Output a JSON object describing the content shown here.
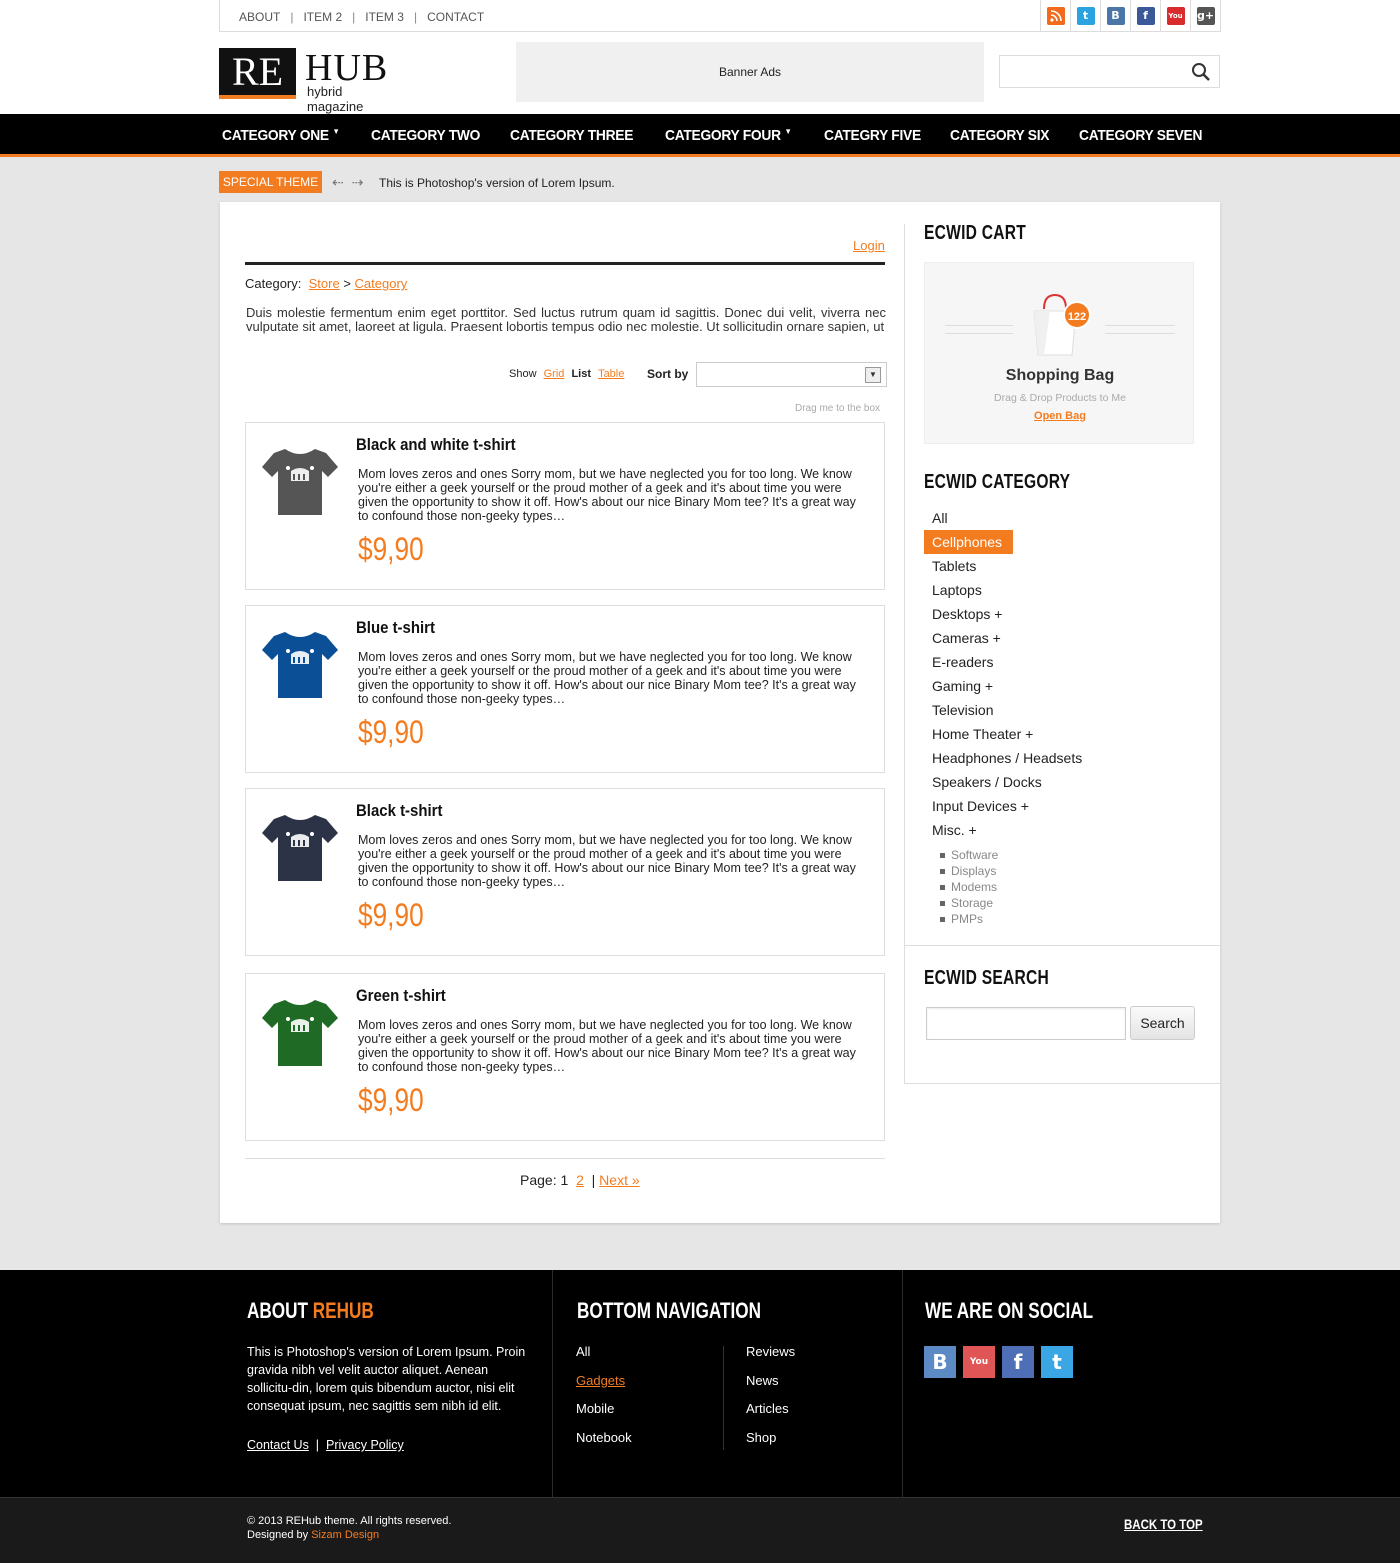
{
  "topnav": {
    "links": [
      "ABOUT",
      "ITEM 2",
      "ITEM 3",
      "CONTACT"
    ],
    "social_icons": [
      "rss-icon",
      "twitter-icon",
      "vk-icon",
      "facebook-icon",
      "youtube-icon",
      "google-plus-icon"
    ]
  },
  "logo": {
    "mark": "RE",
    "name": "HUB",
    "tagline": "hybrid magazine"
  },
  "banner": {
    "text": "Banner Ads"
  },
  "mainnav": {
    "items": [
      "CATEGORY ONE",
      "CATEGORY TWO",
      "CATEGORY THREE",
      "CATEGORY FOUR",
      "CATEGRY FIVE",
      "CATEGORY SIX",
      "CATEGORY SEVEN"
    ]
  },
  "ticker": {
    "badge": "SPECIAL THEME",
    "text": "This is Photoshop's version  of Lorem Ipsum."
  },
  "content": {
    "login": "Login",
    "breadcrumb": {
      "label": "Category:",
      "store": "Store",
      "sep": ">",
      "category": "Category"
    },
    "description": "Duis molestie fermentum enim eget porttitor. Sed luctus rutrum quam id sagittis. Donec dui velit, viverra nec vulputate sit amet, laoreet at ligula. Praesent lobortis tempus odio nec molestie. Ut sollicitudin ornare sapien, ut",
    "show": {
      "label": "Show",
      "grid": "Grid",
      "list": "List",
      "table": "Table"
    },
    "sort": {
      "label": "Sort by",
      "value": ""
    },
    "drag_hint": "Drag me to the box",
    "products": [
      {
        "title": "Black and white t-shirt",
        "desc": "Mom loves zeros and ones Sorry mom, but we have neglected you for too long. We know you're either a geek yourself or the proud mother of a geek and it's about time you were given the opportunity to show it off. How's about our nice Binary Mom tee? It's a great way to confound those non-geeky types…",
        "price": "$9,90",
        "color": "#555555"
      },
      {
        "title": "Blue t-shirt",
        "desc": "Mom loves zeros and ones Sorry mom, but we have neglected you for too long. We know you're either a geek yourself or the proud mother of a geek and it's about time you were given the opportunity to show it off. How's about our nice Binary Mom tee? It's a great way to confound those non-geeky types…",
        "price": "$9,90",
        "color": "#0b4f96"
      },
      {
        "title": "Black t-shirt",
        "desc": "Mom loves zeros and ones Sorry mom, but we have neglected you for too long. We know you're either a geek yourself or the proud mother of a geek and it's about time you were given the opportunity to show it off. How's about our nice Binary Mom tee? It's a great way to confound those non-geeky types…",
        "price": "$9,90",
        "color": "#2c3347"
      },
      {
        "title": "Green t-shirt",
        "desc": "Mom loves zeros and ones Sorry mom, but we have neglected you for too long. We know you're either a geek yourself or the proud mother of a geek and it's about time you were given the opportunity to show it off. How's about our nice Binary Mom tee? It's a great way to confound those non-geeky types…",
        "price": "$9,90",
        "color": "#1f6b26"
      }
    ],
    "pager": {
      "label": "Page:",
      "current": "1",
      "page2": "2",
      "sep": "|",
      "next": "Next »"
    }
  },
  "sidebar": {
    "cart": {
      "heading": "ECWID CART",
      "count": "122",
      "title": "Shopping Bag",
      "hint": "Drag & Drop Products to Me",
      "open": "Open Bag"
    },
    "category": {
      "heading": "ECWID CATEGORY",
      "items": [
        "All",
        "Cellphones",
        "Tablets",
        "Laptops",
        "Desktops +",
        "Cameras +",
        "E-readers",
        "Gaming +",
        "Television",
        "Home Theater +",
        "Headphones / Headsets",
        "Speakers / Docks",
        "Input Devices +",
        "Misc. +"
      ],
      "active": "Cellphones",
      "sub_items": [
        "Software",
        "Displays",
        "Modems",
        "Storage",
        "PMPs"
      ]
    },
    "search": {
      "heading": "ECWID SEARCH",
      "placeholder": "",
      "button": "Search"
    }
  },
  "footer": {
    "about": {
      "heading": "ABOUT",
      "heading_accent": "REHUB",
      "text": "This is Photoshop's version  of Lorem Ipsum. Proin gravida nibh vel velit auctor aliquet. Aenean sollicitu-din, lorem quis bibendum auctor, nisi elit consequat ipsum, nec sagittis sem nibh id elit.",
      "contact": "Contact Us",
      "sep": "|",
      "privacy": "Privacy Policy"
    },
    "nav": {
      "heading": "BOTTOM NAVIGATION",
      "col1": [
        "All",
        "Gadgets",
        "Mobile",
        "Notebook"
      ],
      "col2": [
        "Reviews",
        "News",
        "Articles",
        "Shop"
      ],
      "active": "Gadgets"
    },
    "social": {
      "heading": "WE ARE ON SOCIAL",
      "icons": [
        "vk-icon",
        "youtube-icon",
        "facebook-icon",
        "twitter-icon"
      ]
    },
    "copyright": "© 2013 REHub theme. All rights reserved.",
    "designed_by_label": "Designed by",
    "designer": "Sizam Design",
    "back_to_top": "BACK TO TOP"
  },
  "colors": {
    "accent": "#f47c20",
    "nav_bg": "#000000",
    "footer_bg": "#000000"
  }
}
